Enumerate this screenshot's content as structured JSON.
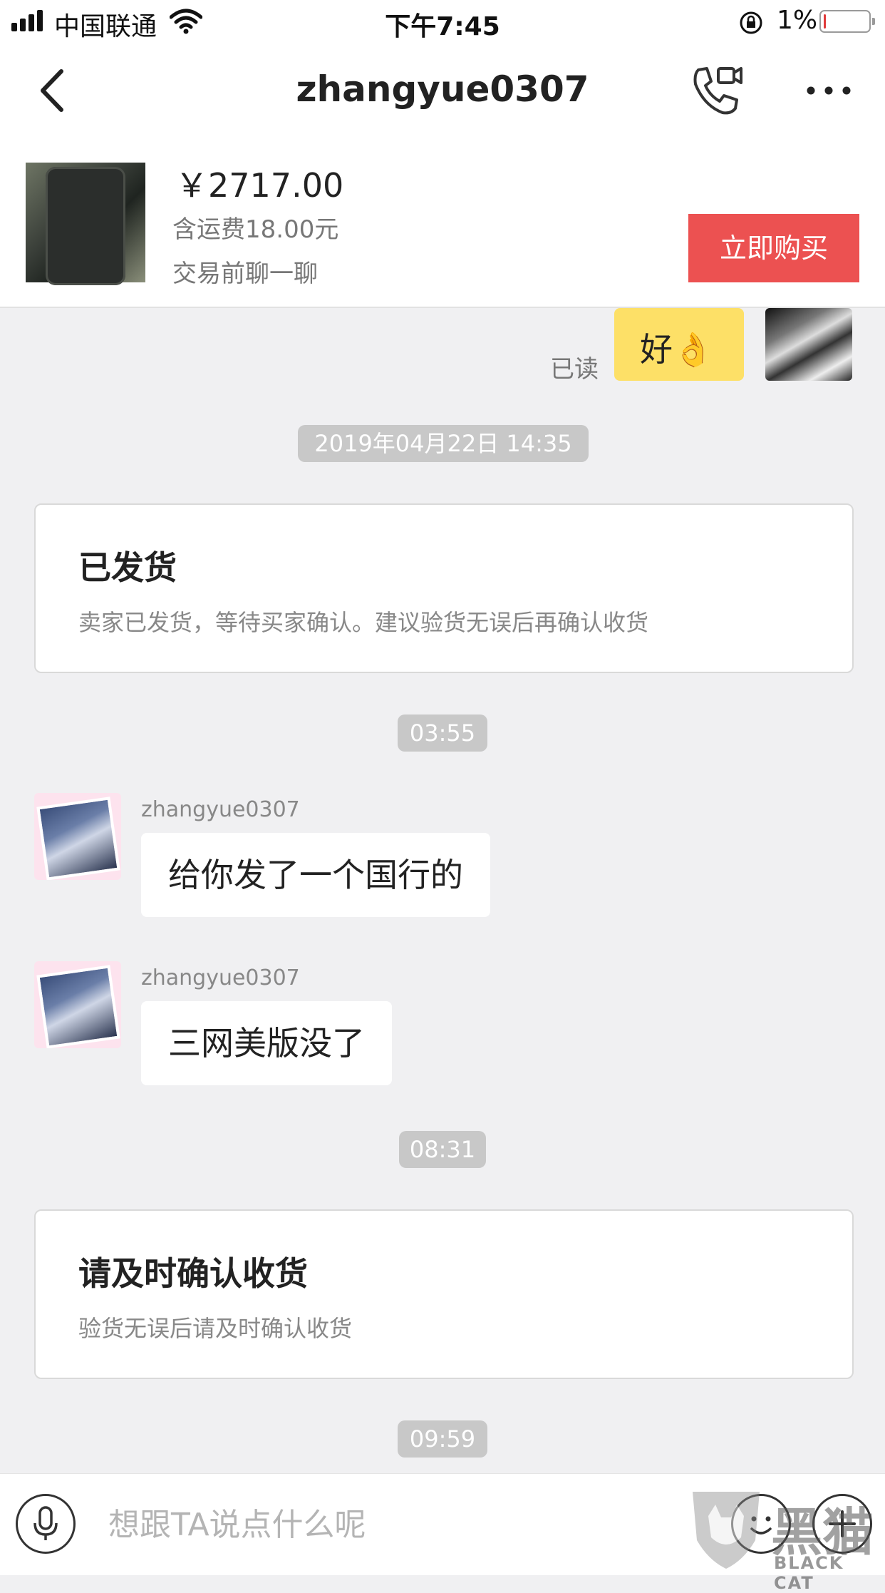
{
  "status_bar": {
    "carrier": "中国联通",
    "time": "下午7:45",
    "battery": "1%",
    "battery_level": 0.01,
    "battery_color": "#e03a3a"
  },
  "nav": {
    "back_icon": "chevron-left-icon",
    "title": "zhangyue0307",
    "video_call_icon": "video-call-icon",
    "more_icon": "more-dots-icon"
  },
  "product": {
    "price": "￥2717.00",
    "shipping": "含运费18.00元",
    "chat_tip": "交易前聊一聊",
    "buy_label": "立即购买",
    "buy_color": "#ec5151"
  },
  "chat": {
    "my_message": {
      "read_label": "已读",
      "text": "好👌",
      "bubble_color": "#fde067"
    },
    "time_1": "2019年04月22日 14:35",
    "card_shipped": {
      "title": "已发货",
      "desc": "卖家已发货，等待买家确认。建议验货无误后再确认收货"
    },
    "time_2": "03:55",
    "messages": [
      {
        "sender": "zhangyue0307",
        "text": "给你发了一个国行的"
      },
      {
        "sender": "zhangyue0307",
        "text": "三网美版没了"
      }
    ],
    "time_3": "08:31",
    "card_confirm": {
      "title": "请及时确认收货",
      "desc": "验货无误后请及时确认收货"
    },
    "time_4": "09:59"
  },
  "input_bar": {
    "voice_icon": "microphone-icon",
    "placeholder": "想跟TA说点什么呢",
    "emoji_icon": "emoji-icon",
    "plus_icon": "plus-icon"
  },
  "watermark": {
    "cn": "黑猫",
    "en": "BLACK CAT"
  }
}
